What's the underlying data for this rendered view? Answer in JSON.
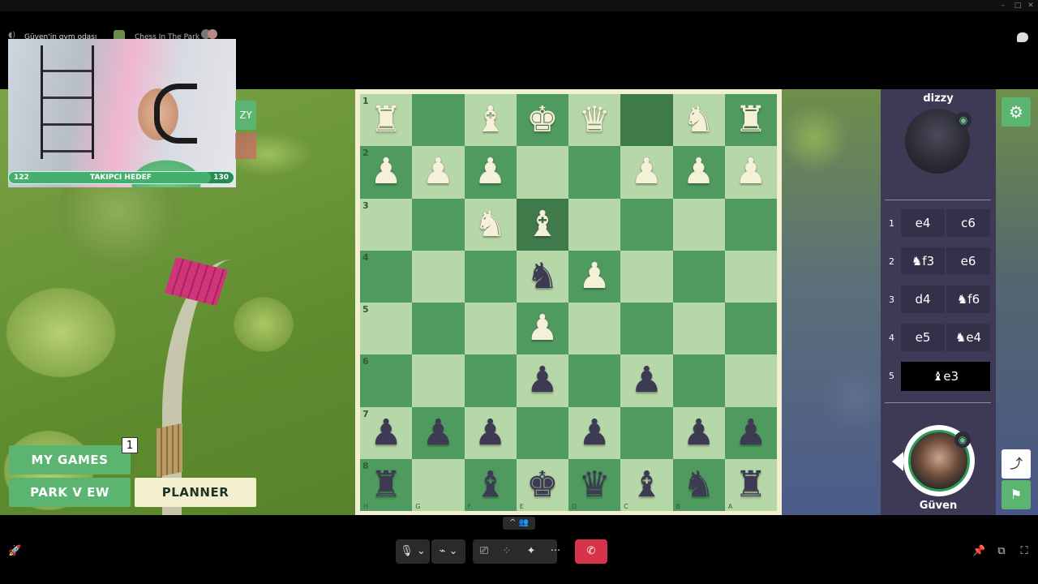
{
  "window": {
    "minimize": "–",
    "maximize": "□",
    "close": "✕"
  },
  "activity": {
    "channel": "Güven'in gym odası",
    "app": "Chess In The Park"
  },
  "webcam": {
    "goal_current": "122",
    "goal_label": "TAKIPCI HEDEF",
    "goal_target": "130",
    "goal_progress": 0.9,
    "tag": "ZY"
  },
  "left_menu": {
    "my_games": "MY GAMES",
    "my_games_badge": "1",
    "park_view": "PARK V EW",
    "planner": "PLANNER"
  },
  "board": {
    "ranks": [
      "1",
      "2",
      "3",
      "4",
      "5",
      "6",
      "7",
      "8"
    ],
    "files": [
      "H",
      "G",
      "F",
      "E",
      "D",
      "C",
      "B",
      "A"
    ],
    "rows": [
      [
        "wR",
        "",
        "wB",
        "wK",
        "wQ",
        "",
        "wN",
        "wR"
      ],
      [
        "wP",
        "wP",
        "wP",
        "",
        "",
        "wP",
        "wP",
        "wP"
      ],
      [
        "",
        "",
        "wN",
        "wB",
        "",
        "",
        "",
        ""
      ],
      [
        "",
        "",
        "",
        "bN",
        "wP",
        "",
        "",
        ""
      ],
      [
        "",
        "",
        "",
        "wP",
        "",
        "",
        "",
        ""
      ],
      [
        "",
        "",
        "",
        "bP",
        "",
        "bP",
        "",
        ""
      ],
      [
        "bP",
        "bP",
        "bP",
        "",
        "bP",
        "",
        "bP",
        "bP"
      ],
      [
        "bR",
        "",
        "bB",
        "bK",
        "bQ",
        "bB",
        "bN",
        "bR"
      ]
    ],
    "highlights": [
      [
        0,
        5
      ],
      [
        2,
        3
      ]
    ]
  },
  "panel": {
    "opponent_name": "dizzy",
    "player_name": "Güven",
    "moves": [
      {
        "num": "1",
        "white": "e4",
        "black": "c6"
      },
      {
        "num": "2",
        "white": "♞f3",
        "black": "e6"
      },
      {
        "num": "3",
        "white": "d4",
        "black": "♞f6"
      },
      {
        "num": "4",
        "white": "e5",
        "black": "♞e4"
      },
      {
        "num": "5",
        "white": "♝e3",
        "black": ""
      }
    ]
  },
  "toolbar": {
    "collapse": "^ 👥",
    "mic": "🎙 ⌄",
    "camera": "⌁ ⌄",
    "share": "⎚",
    "activities": "⁘",
    "effects": "✦",
    "more": "···",
    "leave": "✆"
  },
  "icons": {
    "settings": "⚙",
    "share": "⤴",
    "flag": "⚑",
    "eye": "◉",
    "rocket": "🚀",
    "pin": "📌",
    "popout": "⧉",
    "fullscreen": "⛶"
  },
  "colors": {
    "light_square": "#b6d7a8",
    "dark_square": "#4f9a5f",
    "accent_green": "#5bb470",
    "panel_bg": "#3c3a55",
    "leave_red": "#d8334a"
  }
}
